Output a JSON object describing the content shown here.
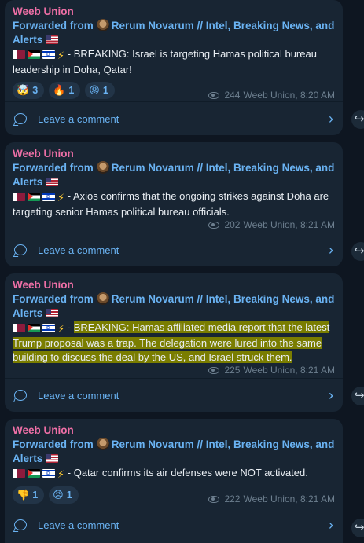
{
  "messages": [
    {
      "author": "Weeb Union",
      "forwarded_prefix": "Forwarded from",
      "forwarded_source": "Rerum Novarum // Intel, Breaking News, and Alerts",
      "text": "- BREAKING: Israel is targeting Hamas political bureau leadership in Doha, Qatar!",
      "highlight": false,
      "reactions": [
        {
          "emoji": "🤯",
          "count": "3"
        },
        {
          "emoji": "🔥",
          "count": "1"
        },
        {
          "emoji": "😡",
          "count": "1"
        }
      ],
      "views": "244",
      "footer": "Weeb Union, 8:20 AM",
      "comment_label": "Leave a comment"
    },
    {
      "author": "Weeb Union",
      "forwarded_prefix": "Forwarded from",
      "forwarded_source": "Rerum Novarum // Intel, Breaking News, and Alerts",
      "text": "- Axios confirms that the ongoing strikes against Doha are targeting senior Hamas political bureau officials.",
      "highlight": false,
      "reactions": [],
      "views": "202",
      "footer": "Weeb Union, 8:21 AM",
      "comment_label": "Leave a comment"
    },
    {
      "author": "Weeb Union",
      "forwarded_prefix": "Forwarded from",
      "forwarded_source": "Rerum Novarum // Intel, Breaking News, and Alerts",
      "text_plain": "- ",
      "text": "BREAKING: Hamas affiliated media report that the latest Trump proposal was a trap. The delegation were lured into the same building to discuss the deal by the US, and Israel struck them.",
      "highlight": true,
      "reactions": [],
      "views": "225",
      "footer": "Weeb Union, 8:21 AM",
      "comment_label": "Leave a comment"
    },
    {
      "author": "Weeb Union",
      "forwarded_prefix": "Forwarded from",
      "forwarded_source": "Rerum Novarum // Intel, Breaking News, and Alerts",
      "text": "- Qatar confirms its air defenses were NOT activated.",
      "highlight": false,
      "reactions": [
        {
          "emoji": "👎",
          "count": "1"
        },
        {
          "emoji": "😡",
          "count": "1"
        }
      ],
      "views": "222",
      "footer": "Weeb Union, 8:21 AM",
      "comment_label": "Leave a comment"
    }
  ],
  "colors": {
    "background": "#0e1621",
    "bubble": "#182533",
    "author": "#ee6fa6",
    "link": "#6ab3f3",
    "meta": "#6d7f8f",
    "highlight": "#7a7d00"
  }
}
